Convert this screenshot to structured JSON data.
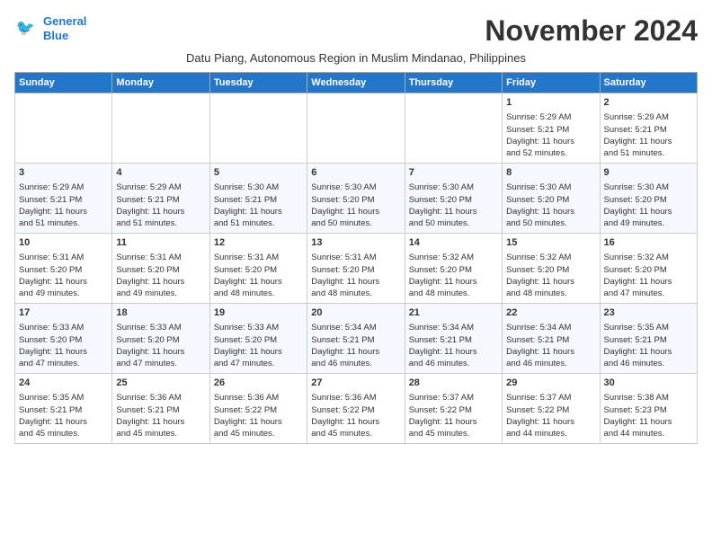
{
  "header": {
    "logo_line1": "General",
    "logo_line2": "Blue",
    "month_title": "November 2024",
    "subtitle": "Datu Piang, Autonomous Region in Muslim Mindanao, Philippines"
  },
  "days_of_week": [
    "Sunday",
    "Monday",
    "Tuesday",
    "Wednesday",
    "Thursday",
    "Friday",
    "Saturday"
  ],
  "weeks": [
    {
      "days": [
        {
          "num": "",
          "content": ""
        },
        {
          "num": "",
          "content": ""
        },
        {
          "num": "",
          "content": ""
        },
        {
          "num": "",
          "content": ""
        },
        {
          "num": "",
          "content": ""
        },
        {
          "num": "1",
          "content": "Sunrise: 5:29 AM\nSunset: 5:21 PM\nDaylight: 11 hours\nand 52 minutes."
        },
        {
          "num": "2",
          "content": "Sunrise: 5:29 AM\nSunset: 5:21 PM\nDaylight: 11 hours\nand 51 minutes."
        }
      ]
    },
    {
      "days": [
        {
          "num": "3",
          "content": "Sunrise: 5:29 AM\nSunset: 5:21 PM\nDaylight: 11 hours\nand 51 minutes."
        },
        {
          "num": "4",
          "content": "Sunrise: 5:29 AM\nSunset: 5:21 PM\nDaylight: 11 hours\nand 51 minutes."
        },
        {
          "num": "5",
          "content": "Sunrise: 5:30 AM\nSunset: 5:21 PM\nDaylight: 11 hours\nand 51 minutes."
        },
        {
          "num": "6",
          "content": "Sunrise: 5:30 AM\nSunset: 5:20 PM\nDaylight: 11 hours\nand 50 minutes."
        },
        {
          "num": "7",
          "content": "Sunrise: 5:30 AM\nSunset: 5:20 PM\nDaylight: 11 hours\nand 50 minutes."
        },
        {
          "num": "8",
          "content": "Sunrise: 5:30 AM\nSunset: 5:20 PM\nDaylight: 11 hours\nand 50 minutes."
        },
        {
          "num": "9",
          "content": "Sunrise: 5:30 AM\nSunset: 5:20 PM\nDaylight: 11 hours\nand 49 minutes."
        }
      ]
    },
    {
      "days": [
        {
          "num": "10",
          "content": "Sunrise: 5:31 AM\nSunset: 5:20 PM\nDaylight: 11 hours\nand 49 minutes."
        },
        {
          "num": "11",
          "content": "Sunrise: 5:31 AM\nSunset: 5:20 PM\nDaylight: 11 hours\nand 49 minutes."
        },
        {
          "num": "12",
          "content": "Sunrise: 5:31 AM\nSunset: 5:20 PM\nDaylight: 11 hours\nand 48 minutes."
        },
        {
          "num": "13",
          "content": "Sunrise: 5:31 AM\nSunset: 5:20 PM\nDaylight: 11 hours\nand 48 minutes."
        },
        {
          "num": "14",
          "content": "Sunrise: 5:32 AM\nSunset: 5:20 PM\nDaylight: 11 hours\nand 48 minutes."
        },
        {
          "num": "15",
          "content": "Sunrise: 5:32 AM\nSunset: 5:20 PM\nDaylight: 11 hours\nand 48 minutes."
        },
        {
          "num": "16",
          "content": "Sunrise: 5:32 AM\nSunset: 5:20 PM\nDaylight: 11 hours\nand 47 minutes."
        }
      ]
    },
    {
      "days": [
        {
          "num": "17",
          "content": "Sunrise: 5:33 AM\nSunset: 5:20 PM\nDaylight: 11 hours\nand 47 minutes."
        },
        {
          "num": "18",
          "content": "Sunrise: 5:33 AM\nSunset: 5:20 PM\nDaylight: 11 hours\nand 47 minutes."
        },
        {
          "num": "19",
          "content": "Sunrise: 5:33 AM\nSunset: 5:20 PM\nDaylight: 11 hours\nand 47 minutes."
        },
        {
          "num": "20",
          "content": "Sunrise: 5:34 AM\nSunset: 5:21 PM\nDaylight: 11 hours\nand 46 minutes."
        },
        {
          "num": "21",
          "content": "Sunrise: 5:34 AM\nSunset: 5:21 PM\nDaylight: 11 hours\nand 46 minutes."
        },
        {
          "num": "22",
          "content": "Sunrise: 5:34 AM\nSunset: 5:21 PM\nDaylight: 11 hours\nand 46 minutes."
        },
        {
          "num": "23",
          "content": "Sunrise: 5:35 AM\nSunset: 5:21 PM\nDaylight: 11 hours\nand 46 minutes."
        }
      ]
    },
    {
      "days": [
        {
          "num": "24",
          "content": "Sunrise: 5:35 AM\nSunset: 5:21 PM\nDaylight: 11 hours\nand 45 minutes."
        },
        {
          "num": "25",
          "content": "Sunrise: 5:36 AM\nSunset: 5:21 PM\nDaylight: 11 hours\nand 45 minutes."
        },
        {
          "num": "26",
          "content": "Sunrise: 5:36 AM\nSunset: 5:22 PM\nDaylight: 11 hours\nand 45 minutes."
        },
        {
          "num": "27",
          "content": "Sunrise: 5:36 AM\nSunset: 5:22 PM\nDaylight: 11 hours\nand 45 minutes."
        },
        {
          "num": "28",
          "content": "Sunrise: 5:37 AM\nSunset: 5:22 PM\nDaylight: 11 hours\nand 45 minutes."
        },
        {
          "num": "29",
          "content": "Sunrise: 5:37 AM\nSunset: 5:22 PM\nDaylight: 11 hours\nand 44 minutes."
        },
        {
          "num": "30",
          "content": "Sunrise: 5:38 AM\nSunset: 5:23 PM\nDaylight: 11 hours\nand 44 minutes."
        }
      ]
    }
  ]
}
